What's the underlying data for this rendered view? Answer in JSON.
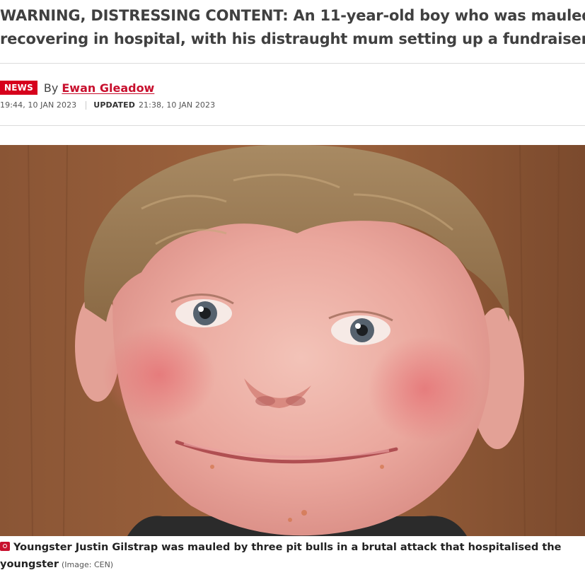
{
  "article": {
    "standfirst_line1": "WARNING, DISTRESSING CONTENT: An 11-year-old boy who was mauled by thre",
    "standfirst_line2": "recovering in hospital, with his distraught mum setting up a fundraiser to cover",
    "category_badge": "NEWS",
    "by_label": "By",
    "author": "Ewan Gleadow",
    "published": "19:44, 10 JAN 2023",
    "updated_label": "UPDATED",
    "updated": "21:38, 10 JAN 2023"
  },
  "photo": {
    "caption": "Youngster Justin Gilstrap was mauled by three pit bulls in a brutal attack that hospitalised the youngster",
    "credit": "(Image: CEN)",
    "caption_icon": "camera-icon"
  },
  "colors": {
    "brand_red": "#d6001c",
    "author_red": "#c8102e",
    "rule": "#dcdcdc"
  }
}
